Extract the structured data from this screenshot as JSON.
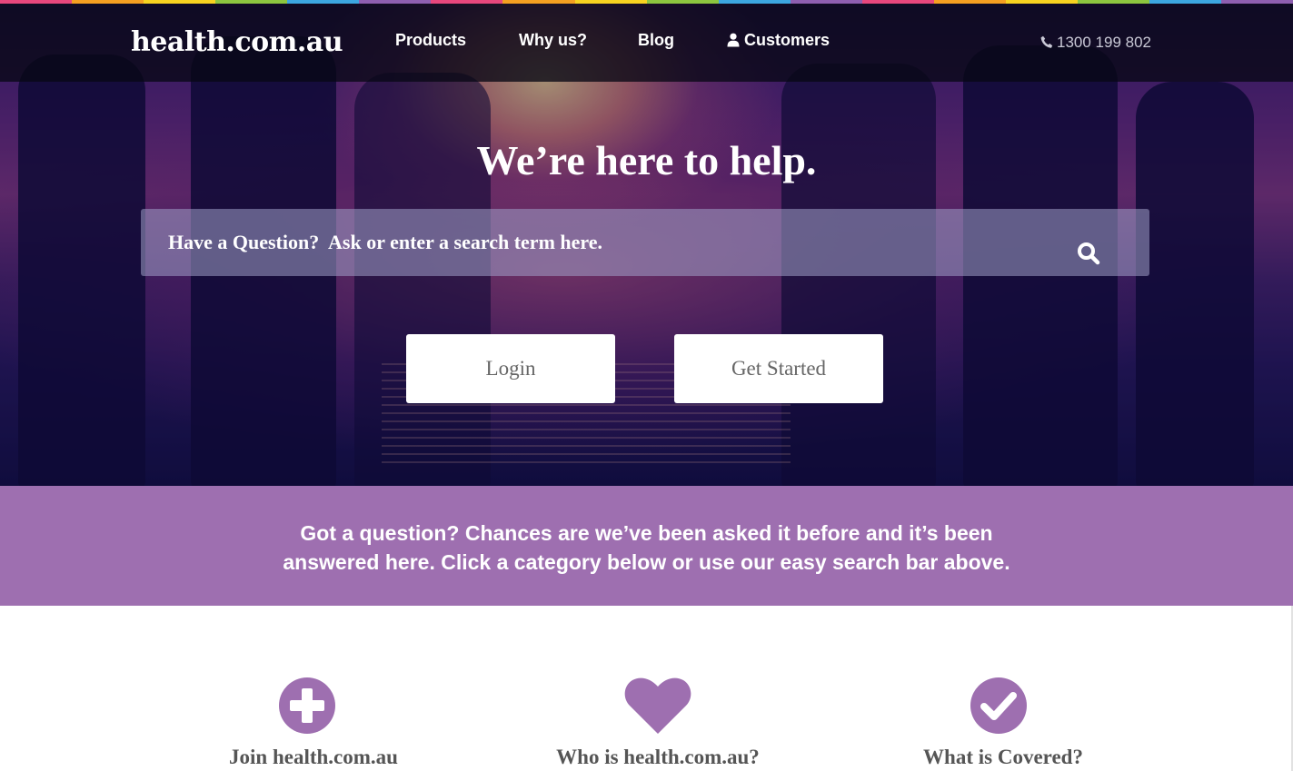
{
  "header": {
    "logo": "health.com.au",
    "nav": [
      {
        "label": "Products",
        "icon": null
      },
      {
        "label": "Why us?",
        "icon": null
      },
      {
        "label": "Blog",
        "icon": null
      },
      {
        "label": "Customers",
        "icon": "user-icon"
      }
    ],
    "phone": {
      "icon": "phone-icon",
      "number": "1300 199 802"
    }
  },
  "hero": {
    "headline": "We’re here to help.",
    "search": {
      "placeholder": "Have a Question?  Ask or enter a search term here.",
      "value": "",
      "icon": "search-icon"
    },
    "buttons": {
      "login": "Login",
      "get_started": "Get Started"
    }
  },
  "info_band": {
    "line1": "Got a question? Chances are we’ve been asked it before and it’s been",
    "line2": "answered here. Click a category below or use our easy search bar above."
  },
  "categories": [
    {
      "title": "Join health.com.au",
      "icon": "plus-circle-icon"
    },
    {
      "title": "Who is health.com.au?",
      "icon": "heart-icon"
    },
    {
      "title": "What is Covered?",
      "icon": "check-circle-icon"
    }
  ],
  "colors": {
    "accent_purple": "#9e6fb0",
    "header_bg": "#0a0a14",
    "rainbow": [
      "#e8477d",
      "#f4a021",
      "#f7d320",
      "#8cc63f",
      "#3ca7e0",
      "#8e5fb0"
    ]
  }
}
